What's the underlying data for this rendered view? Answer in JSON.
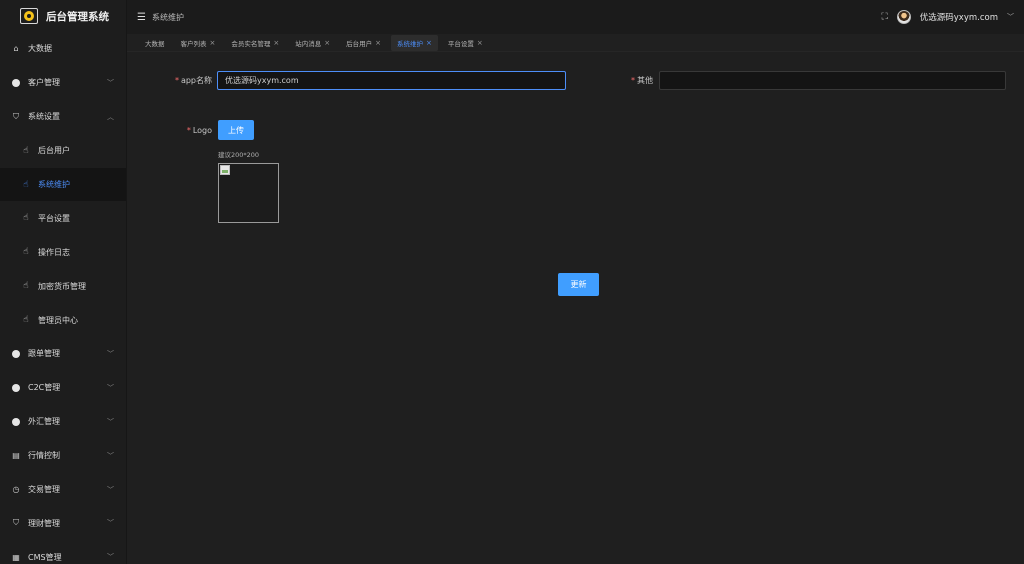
{
  "app": {
    "title": "后台管理系统"
  },
  "sidebar": {
    "items": [
      {
        "label": "大数据",
        "icon": "home-icon",
        "arrow": ""
      },
      {
        "label": "客户管理",
        "icon": "dot-icon",
        "arrow": "﹀"
      },
      {
        "label": "系统设置",
        "icon": "shield-icon",
        "arrow": "︿"
      },
      {
        "label": "后台用户",
        "icon": "hand-icon",
        "arrow": "",
        "sub": true
      },
      {
        "label": "系统维护",
        "icon": "hand-icon",
        "arrow": "",
        "sub": true,
        "active": true
      },
      {
        "label": "平台设置",
        "icon": "hand-icon",
        "arrow": "",
        "sub": true
      },
      {
        "label": "操作日志",
        "icon": "hand-icon",
        "arrow": "",
        "sub": true
      },
      {
        "label": "加密货币管理",
        "icon": "hand-icon",
        "arrow": "",
        "sub": true
      },
      {
        "label": "管理员中心",
        "icon": "hand-icon",
        "arrow": "",
        "sub": true
      },
      {
        "label": "跟单管理",
        "icon": "dot-icon",
        "arrow": "﹀"
      },
      {
        "label": "C2C管理",
        "icon": "dot-icon",
        "arrow": "﹀"
      },
      {
        "label": "外汇管理",
        "icon": "dot-icon",
        "arrow": "﹀"
      },
      {
        "label": "行情控制",
        "icon": "chart-icon",
        "arrow": "﹀"
      },
      {
        "label": "交易管理",
        "icon": "clock-icon",
        "arrow": "﹀"
      },
      {
        "label": "理财管理",
        "icon": "shield-icon",
        "arrow": "﹀"
      },
      {
        "label": "CMS管理",
        "icon": "doc-icon",
        "arrow": "﹀"
      }
    ]
  },
  "header": {
    "breadcrumb": "系统维护",
    "user": "优选源码yxym.com"
  },
  "tabs": [
    {
      "label": "大数据",
      "closable": false
    },
    {
      "label": "客户列表",
      "closable": true
    },
    {
      "label": "会员实名管理",
      "closable": true
    },
    {
      "label": "站内消息",
      "closable": true
    },
    {
      "label": "后台用户",
      "closable": true
    },
    {
      "label": "系统维护",
      "closable": true,
      "active": true
    },
    {
      "label": "平台设置",
      "closable": true
    }
  ],
  "form": {
    "app_name_label": "app名称",
    "app_name_value": "优选源码yxym.com",
    "other_label": "其他",
    "other_value": "",
    "logo_label": "Logo",
    "upload_button": "上传",
    "size_hint": "建议200*200",
    "submit_button": "更新"
  },
  "colors": {
    "accent": "#409eff",
    "active_text": "#4d8ef8",
    "required": "#f56c6c"
  }
}
